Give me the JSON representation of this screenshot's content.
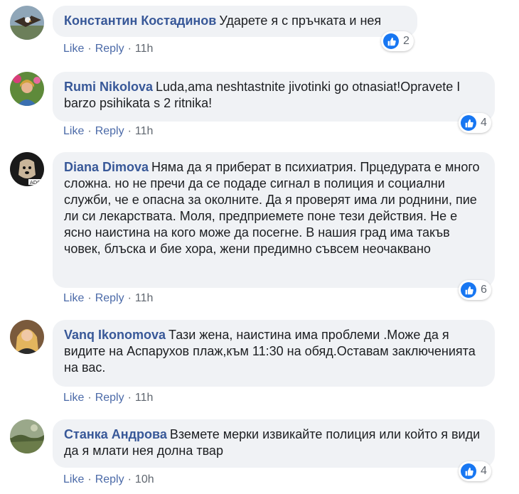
{
  "accent_color": "#1877f2",
  "comments": [
    {
      "author": "Константин Костадинов",
      "text": "Ударете я с пръчката и нея",
      "actions": {
        "like": "Like",
        "reply": "Reply",
        "time": "11h"
      },
      "reactions": "2",
      "avatar_icon": "avatar-eagle"
    },
    {
      "author": "Rumi Nikolova",
      "text": "Luda,ama neshtastnite jivotinki go otnasiat!Opravete I barzo psihikata s 2 ritnika!",
      "actions": {
        "like": "Like",
        "reply": "Reply",
        "time": "11h"
      },
      "reactions": "4",
      "avatar_icon": "avatar-person-flowers"
    },
    {
      "author": "Diana Dimova",
      "text": "Няма да я приберат в психиатрия. Прцедурата е много сложна. но не пречи да се подаде сигнал в полиция и социални служби, че е опасна за околните. Да я проверят има ли роднини, пие ли си лекарствата. Моля, предприемете поне тези действия. Не е ясно наистина на кого може да посегне. В нашия град има такъв човек, блъска и бие хора, жени предимно съвсем неочаквано",
      "actions": {
        "like": "Like",
        "reply": "Reply",
        "time": "11h"
      },
      "reactions": "6",
      "avatar_icon": "avatar-dog-adopt"
    },
    {
      "author": "Vanq Ikonomova",
      "text": "Тази жена, наистина има проблеми .Може да я видите на Аспарухов плаж,към 11:30 на обяд.Оставам заключенията на вас.",
      "actions": {
        "like": "Like",
        "reply": "Reply",
        "time": "11h"
      },
      "reactions": "",
      "avatar_icon": "avatar-woman-blonde"
    },
    {
      "author": "Станка Андрова",
      "text": "Вземете мерки извикайте полиция или който я види да я млати нея долна твар",
      "actions": {
        "like": "Like",
        "reply": "Reply",
        "time": "10h"
      },
      "reactions": "4",
      "avatar_icon": "avatar-landscape"
    }
  ]
}
